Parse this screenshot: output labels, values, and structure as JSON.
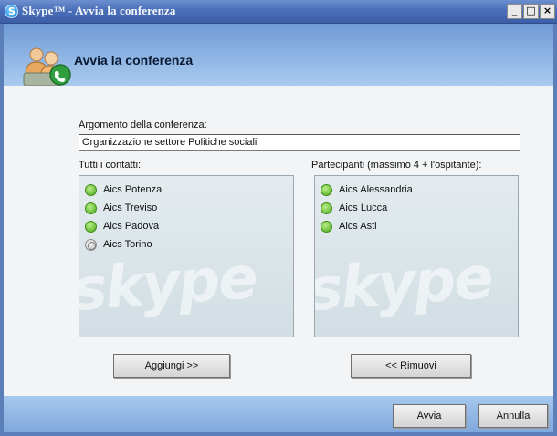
{
  "window": {
    "title": "Skype™ - Avvia la conferenza",
    "minimize_label": "_",
    "maximize_label": "□",
    "close_label": "×"
  },
  "header": {
    "title": "Avvia la conferenza",
    "icon": "conference-icon"
  },
  "topic": {
    "label": "Argomento della conferenza:",
    "value": "Organizzazione settore Politiche sociali"
  },
  "contacts": {
    "label": "Tutti i contatti:",
    "items": [
      {
        "name": "Aics Potenza",
        "status": "online"
      },
      {
        "name": "Aics Treviso",
        "status": "online"
      },
      {
        "name": "Aics Padova",
        "status": "online"
      },
      {
        "name": "Aics Torino",
        "status": "offline"
      }
    ]
  },
  "participants": {
    "label": "Partecipanti (massimo 4 + l'ospitante):",
    "items": [
      {
        "name": "Aics Alessandria",
        "status": "online"
      },
      {
        "name": "Aics Lucca",
        "status": "online"
      },
      {
        "name": "Aics Asti",
        "status": "online"
      }
    ]
  },
  "watermark": "skype",
  "buttons": {
    "add": "Aggiungi >>",
    "remove": "<< Rimuovi",
    "start": "Avvia",
    "cancel": "Annulla"
  },
  "colors": {
    "online": "#4aa51a",
    "offline": "#b8b8b8",
    "titlebar": "#3c5fa7"
  }
}
